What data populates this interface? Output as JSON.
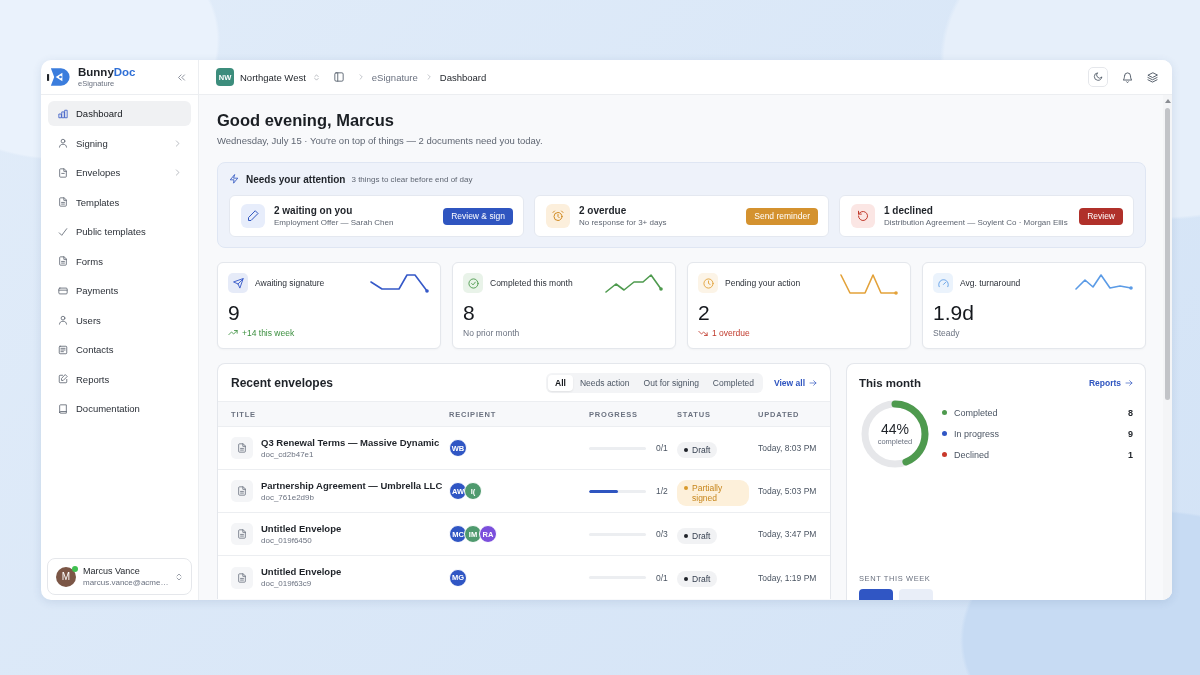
{
  "sidebar": {
    "brand": {
      "name": "Bunny",
      "name_accent": "Doc",
      "subtitle": "eSignature"
    },
    "items": [
      {
        "label": "Dashboard",
        "selected": true,
        "expandable": false
      },
      {
        "label": "Signing",
        "selected": false,
        "expandable": true
      },
      {
        "label": "Envelopes",
        "selected": false,
        "expandable": true
      },
      {
        "label": "Templates",
        "selected": false,
        "expandable": false
      },
      {
        "label": "Public templates",
        "selected": false,
        "expandable": false
      },
      {
        "label": "Forms",
        "selected": false,
        "expandable": false
      },
      {
        "label": "Payments",
        "selected": false,
        "expandable": false
      },
      {
        "label": "Users",
        "selected": false,
        "expandable": false
      },
      {
        "label": "Contacts",
        "selected": false,
        "expandable": false
      },
      {
        "label": "Reports",
        "selected": false,
        "expandable": false
      },
      {
        "label": "Documentation",
        "selected": false,
        "expandable": false
      }
    ],
    "user": {
      "initial": "M",
      "name": "Marcus Vance",
      "email": "marcus.vance@acme…",
      "online": true
    }
  },
  "header": {
    "workspace": {
      "initials": "NW",
      "name": "Northgate West"
    },
    "breadcrumbs": [
      {
        "label": "eSignature",
        "current": false
      },
      {
        "label": "Dashboard",
        "current": true
      }
    ]
  },
  "greeting": {
    "title": "Good evening, Marcus",
    "subtitle": "Wednesday, July 15 · You're on top of things — 2 documents need you today."
  },
  "attention": {
    "title": "Needs your attention",
    "note": "3 things to clear before end of day",
    "items": [
      {
        "kind": "info",
        "title": "2 waiting on you",
        "detail": "Employment Offer — Sarah Chen",
        "action": "Review & sign"
      },
      {
        "kind": "warning",
        "title": "2 overdue",
        "detail": "No response for 3+ days",
        "action": "Send reminder"
      },
      {
        "kind": "danger",
        "title": "1 declined",
        "detail": "Distribution Agreement — Soylent Co · Morgan Ellis",
        "action": "Review"
      }
    ]
  },
  "stats": [
    {
      "label": "Awaiting signature",
      "value": "9",
      "note": "+14 this week",
      "kind": "up",
      "color": "#3558c8"
    },
    {
      "label": "Completed this month",
      "value": "8",
      "note": "No prior month",
      "kind": "neutral",
      "color": "#4e9a4e"
    },
    {
      "label": "Pending your action",
      "value": "2",
      "note": "1 overdue",
      "kind": "down",
      "color": "#e3a23a"
    },
    {
      "label": "Avg. turnaround",
      "value": "1.9d",
      "note": "Steady",
      "kind": "neutral",
      "color": "#5b9be6"
    }
  ],
  "envelopes": {
    "title": "Recent envelopes",
    "filters": [
      {
        "label": "All",
        "selected": true
      },
      {
        "label": "Needs action",
        "selected": false
      },
      {
        "label": "Out for signing",
        "selected": false
      },
      {
        "label": "Completed",
        "selected": false
      }
    ],
    "view_all": "View all",
    "columns": [
      "TITLE",
      "RECIPIENT",
      "PROGRESS",
      "STATUS",
      "UPDATED"
    ],
    "rows": [
      {
        "title": "Q3 Renewal Terms — Massive Dynamic",
        "id": "doc_cd2b47e1",
        "recipients": [
          {
            "initials": "WB",
            "color": "#3056c4"
          }
        ],
        "progress": {
          "level": 0,
          "label": "0/1"
        },
        "status": {
          "kind": "draft",
          "label": "Draft"
        },
        "updated": "Today, 8:03 PM"
      },
      {
        "title": "Partnership Agreement — Umbrella LLC",
        "id": "doc_761e2d9b",
        "recipients": [
          {
            "initials": "AW",
            "color": "#3056c4"
          },
          {
            "initials": "I(",
            "color": "#4f9a6e"
          }
        ],
        "progress": {
          "level": 0.5,
          "label": "1/2"
        },
        "status": {
          "kind": "partial",
          "label": "Partially signed"
        },
        "updated": "Today, 5:03 PM"
      },
      {
        "title": "Untitled Envelope",
        "id": "doc_019f6450",
        "recipients": [
          {
            "initials": "MC",
            "color": "#3056c4"
          },
          {
            "initials": "IM",
            "color": "#4f9a6e"
          },
          {
            "initials": "RA",
            "color": "#7b4fdc"
          }
        ],
        "progress": {
          "level": 0,
          "label": "0/3"
        },
        "status": {
          "kind": "draft",
          "label": "Draft"
        },
        "updated": "Today, 3:47 PM"
      },
      {
        "title": "Untitled Envelope",
        "id": "doc_019f63c9",
        "recipients": [
          {
            "initials": "MG",
            "color": "#3056c4"
          }
        ],
        "progress": {
          "level": 0,
          "label": "0/1"
        },
        "status": {
          "kind": "draft",
          "label": "Draft"
        },
        "updated": "Today, 1:19 PM"
      }
    ]
  },
  "month": {
    "title": "This month",
    "link": "Reports",
    "ring": {
      "level": 0.44,
      "value": "44%",
      "label": "completed"
    },
    "legend": [
      {
        "label": "Completed",
        "value": "8",
        "color": "#4e9a4e"
      },
      {
        "label": "In progress",
        "value": "9",
        "color": "#3056c4"
      },
      {
        "label": "Declined",
        "value": "1",
        "color": "#c8392b"
      }
    ],
    "week_title": "SENT THIS WEEK"
  }
}
